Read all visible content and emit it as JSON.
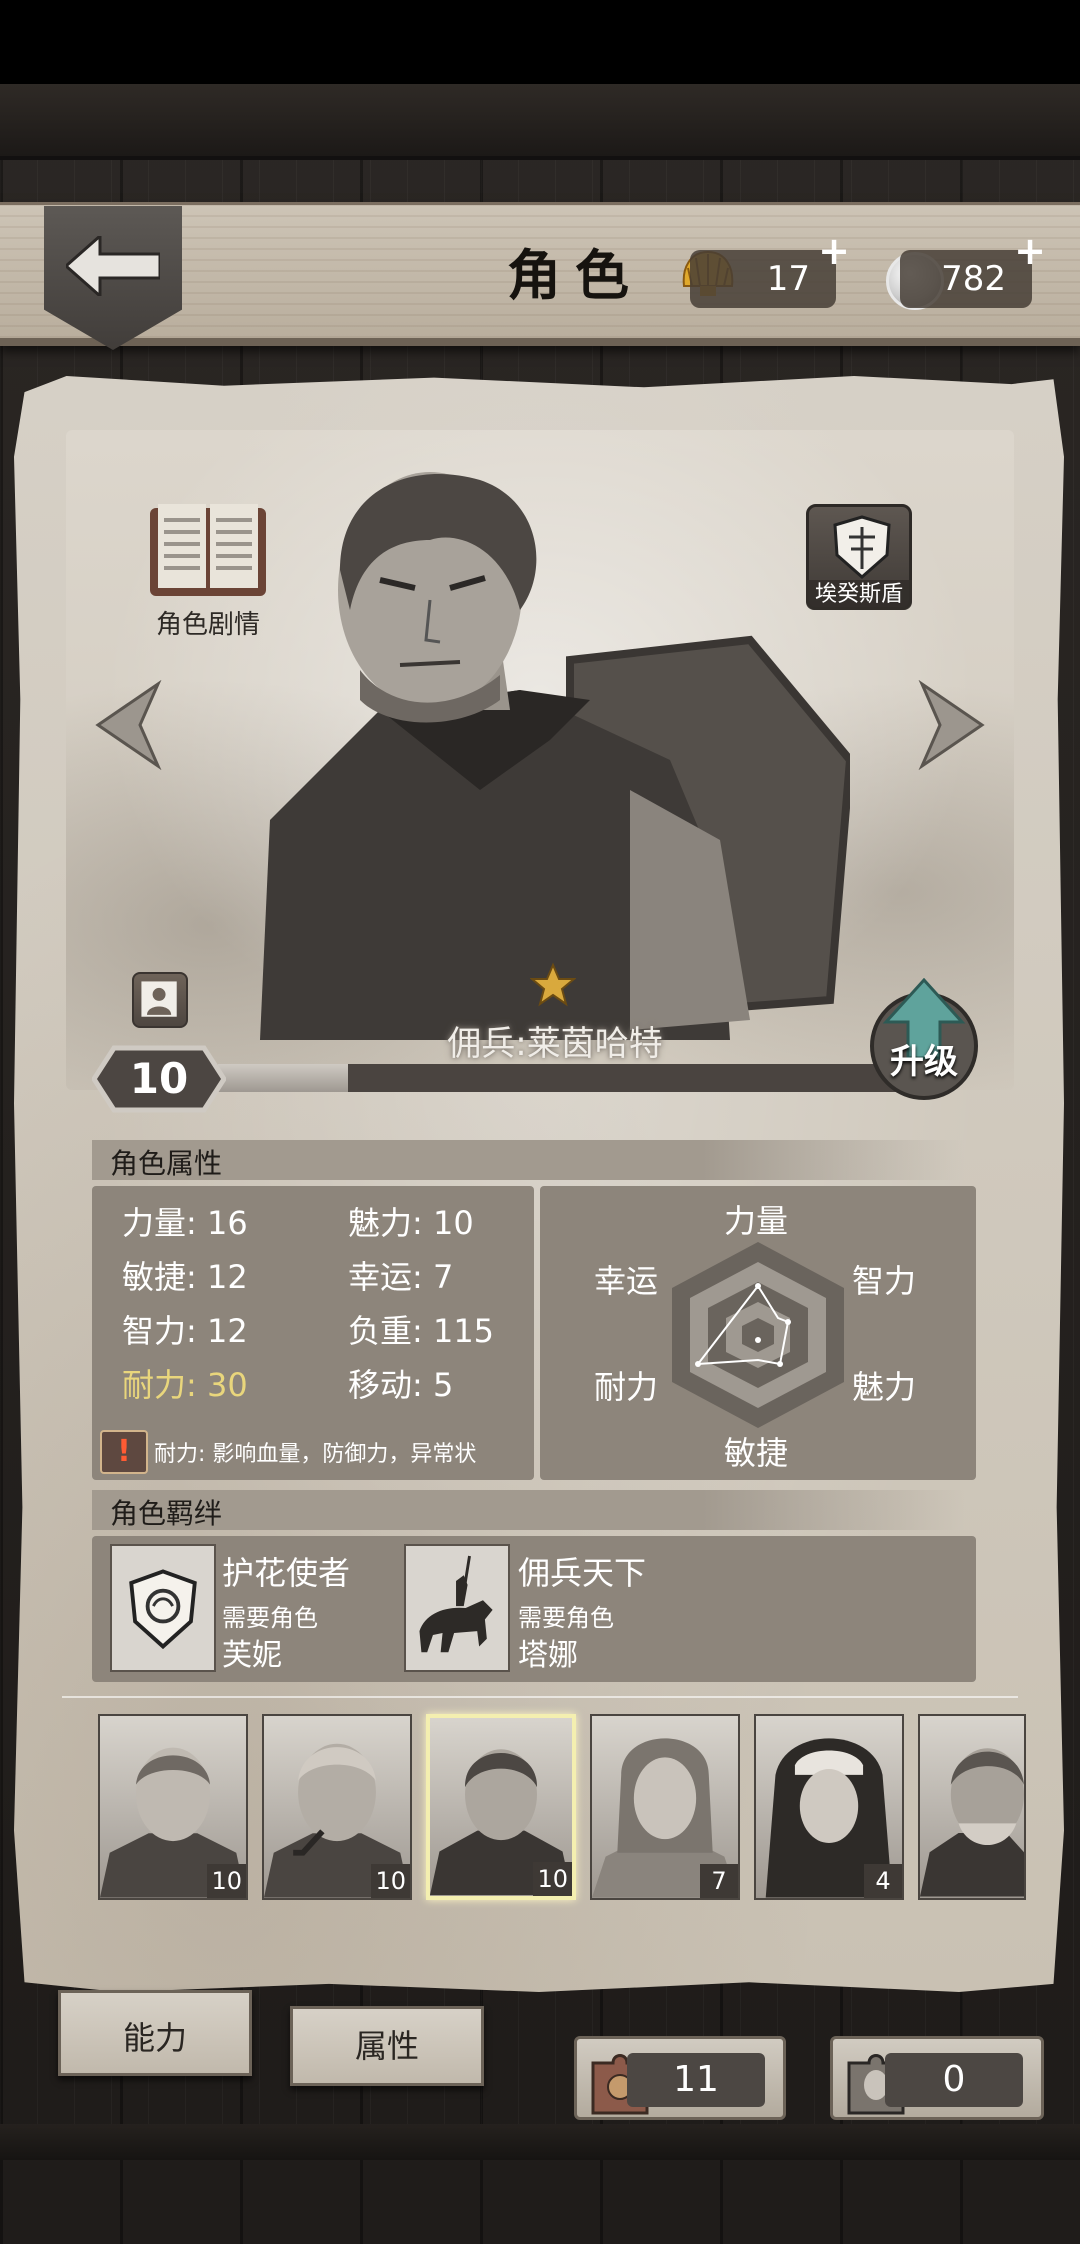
{
  "header": {
    "title": "角色"
  },
  "currencies": [
    {
      "name": "shell",
      "value": "17",
      "plus": "+"
    },
    {
      "name": "coin",
      "value": "782",
      "plus": "+"
    }
  ],
  "portrait": {
    "story_label": "角色剧情",
    "shield_label": "埃癸斯盾",
    "star_rating": 1,
    "hero_name": "佣兵:莱茵哈特",
    "level": "10",
    "xp_fraction": 0.19,
    "upgrade_label": "升级"
  },
  "attributes": {
    "header": "角色属性",
    "items": [
      {
        "label": "力量: 16"
      },
      {
        "label": "魅力: 10"
      },
      {
        "label": "敏捷: 12"
      },
      {
        "label": "幸运: 7"
      },
      {
        "label": "智力: 12"
      },
      {
        "label": "负重: 115"
      },
      {
        "label": "耐力: 30",
        "highlight": true
      },
      {
        "label": "移动: 5"
      }
    ],
    "tip_icon": "!",
    "tip": "耐力: 影响血量，防御力，异常状",
    "radar_labels": {
      "top": "力量",
      "top_right": "智力",
      "bottom_right": "魅力",
      "bottom": "敏捷",
      "bottom_left": "耐力",
      "top_left": "幸运"
    }
  },
  "bonds": {
    "header": "角色羁绊",
    "items": [
      {
        "title": "护花使者",
        "sub": "需要角色",
        "character": "芙妮",
        "icon": "rose-shield-icon"
      },
      {
        "title": "佣兵天下",
        "sub": "需要角色",
        "character": "塔娜",
        "icon": "knight-on-horse-icon"
      }
    ]
  },
  "heroes": [
    {
      "level": "10",
      "icon": "blond-man-portrait"
    },
    {
      "level": "10",
      "icon": "pipe-old-man-portrait"
    },
    {
      "level": "10",
      "icon": "scarred-mercenary-portrait",
      "active": true
    },
    {
      "level": "7",
      "icon": "young-woman-portrait"
    },
    {
      "level": "4",
      "icon": "nun-portrait"
    },
    {
      "level": "",
      "icon": "bearded-old-man-portrait"
    }
  ],
  "tabs": {
    "ability": "能力",
    "attributes": "属性"
  },
  "resources": [
    {
      "name": "badge-puzzle",
      "value": "11"
    },
    {
      "name": "portrait-puzzle",
      "value": "0"
    }
  ],
  "colors": {
    "parchment": "#d3ccc1",
    "panel": "#8d857b",
    "highlight": "#e9d67c",
    "dark_wood": "#2b2724"
  }
}
